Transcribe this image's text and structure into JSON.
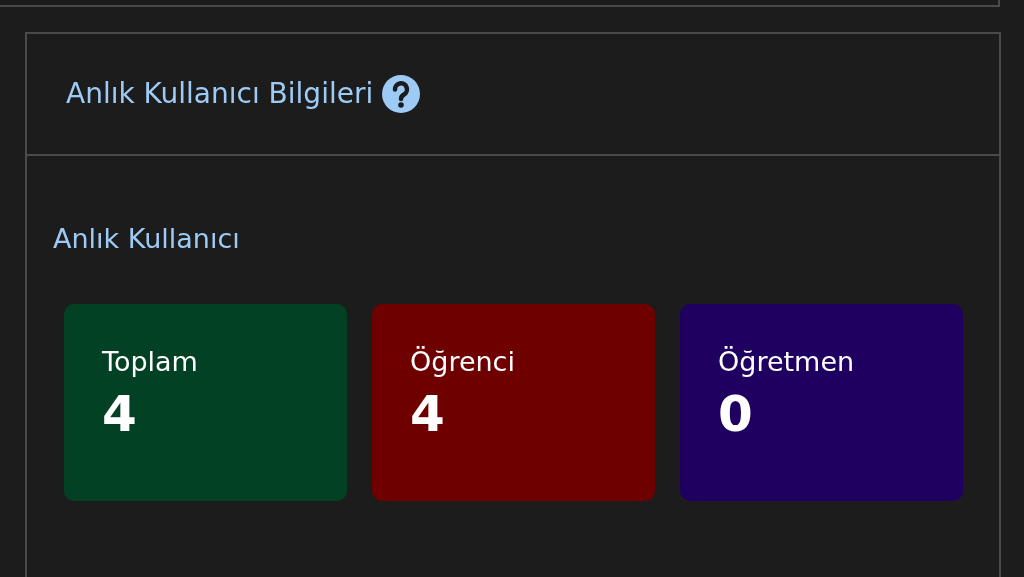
{
  "panel": {
    "title": "Anlık Kullanıcı Bilgileri",
    "section_title": "Anlık Kullanıcı",
    "stats": [
      {
        "label": "Toplam",
        "value": "4",
        "color": "#034125"
      },
      {
        "label": "Öğrenci",
        "value": "4",
        "color": "#6f0000"
      },
      {
        "label": "Öğretmen",
        "value": "0",
        "color": "#1f0060"
      }
    ]
  }
}
